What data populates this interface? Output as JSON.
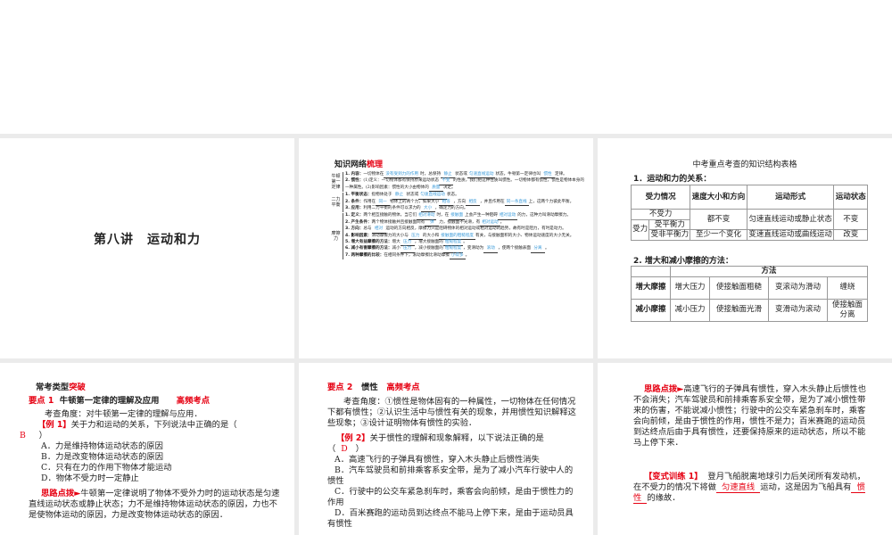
{
  "slide1": {
    "title": "第八讲　运动和力"
  },
  "slide2": {
    "title_black": "知识网络",
    "title_red": "梳理",
    "groups": [
      {
        "label": "牛顿第一定律",
        "items": [
          [
            "1. 内容：",
            "一切物体在",
            [
              "没有受到力的作用"
            ],
            "时，总保持",
            [
              "静止"
            ],
            "状态或",
            [
              "匀速直线运动"
            ],
            "状态，牛顿第一定律也叫",
            [
              "惯性"
            ],
            "定律。"
          ],
          [
            "2. 惯性：",
            "(1)定义：一切物体都有保持原来运动状态",
            [
              "不变"
            ],
            "的性质，我们把这种性质叫惯性。一切物体都有惯性，惯性是物体本身的一种属性。(2)影响因素：惯性的大小由物体的",
            [
              "质量"
            ],
            "决定。"
          ]
        ]
      },
      {
        "label": "二力平衡",
        "items": [
          [
            "1. 平衡状态：",
            "指物体处于",
            [
              "静止"
            ],
            "状态或",
            [
              "匀速直线运动"
            ],
            "状态。"
          ],
          [
            "2. 条件：",
            "作用在",
            [
              "同一"
            ],
            "物体上的两个力，如果大小",
            [
              "相等"
            ],
            "，方向",
            [
              "相反"
            ],
            "，并且作用在",
            [
              "同一条直线"
            ],
            "上，这两个力彼此平衡。"
          ],
          [
            "3. 应用：",
            "利用二力平衡的条件可以求力的",
            [
              "大小"
            ],
            "，确定力的方向。"
          ]
        ]
      },
      {
        "label": "摩擦力",
        "items": [
          [
            "1. 定义：",
            "两个相互接触的物体，当它们",
            [
              "相对滑动"
            ],
            "时，在",
            [
              "接触面"
            ],
            "上会产生一种阻碍",
            [
              "相对运动"
            ],
            "的力，这种力叫滑动摩擦力。"
          ],
          [
            "2. 产生条件：",
            "两个物体接触并且接触面间有",
            [
              "弹"
            ],
            "力，接触面不光滑，有",
            [
              "相对运动"
            ],
            "。"
          ],
          [
            "3. 方向：",
            "总与",
            [
              "相对"
            ],
            "运动的方向相反，摩擦力只是阻碍物体的相对运动或相对运动的趋势，故有时是阻力，有时是动力。"
          ],
          [
            "4. 影响因素：",
            "滑动摩擦力的大小与",
            [
              "压力"
            ],
            "的大小和",
            [
              "接触面的粗糙程度"
            ],
            "有关，与接触面积的大小、物体运动速度的大小无关。"
          ],
          [
            "5. 增大有益摩擦的方法：",
            "增大",
            [
              "压力"
            ],
            "，增大接触面的",
            [
              "粗糙程度"
            ],
            "。"
          ],
          [
            "6. 减小有害摩擦的方法：",
            "减小",
            [
              "压力"
            ],
            "，减小接触面的",
            [
              "粗糙程度"
            ],
            "，变滑动为",
            [
              "滚动"
            ],
            "，使两个接触表面",
            [
              "分离"
            ],
            "。"
          ],
          [
            "7. 两种摩擦的比较：",
            "在相同条件下，滚动摩擦比滑动摩擦",
            [
              "小得多"
            ],
            "。"
          ]
        ]
      }
    ]
  },
  "slide3": {
    "heading": "中考重点考查的知识结构表格",
    "sub1": "1．运动和力的关系：",
    "t1": {
      "h": [
        "受力情况",
        "速度大小和方向",
        "运动形式",
        "运动状态"
      ],
      "r1": [
        "不受力",
        "都不变",
        "匀速直线运动或静止状态",
        "不变"
      ],
      "r2": "受平衡力",
      "r3": [
        "受力",
        "受非平衡力",
        "至少一个变化",
        "变速直线运动或曲线运动",
        "改变"
      ]
    },
    "sub2": "2. 增大和减小摩擦的方法：",
    "t2": {
      "h": "方法",
      "r1": [
        "增大摩擦",
        "增大压力",
        "使接触面粗糙",
        "变滚动为滑动",
        "缠绕"
      ],
      "r2": [
        "减小摩擦",
        "减小压力",
        "使接触面光滑",
        "变滑动为滚动",
        "使接触面分离"
      ]
    }
  },
  "slide4": {
    "h_black": "常考类型",
    "h_red": "突破",
    "point_red": "要点 1",
    "point": "牛顿第一定律的理解及应用",
    "freq": "高频考点",
    "angle": "考查角度：对牛顿第一定律的理解与应用．",
    "ex": "【例 1】",
    "q": "关于力和运动的关系，下列说法中正确的是（",
    "ans": "B",
    "close": "）",
    "opts": [
      "A．力是维持物体运动状态的原因",
      "B．力是改变物体运动状态的原因",
      "C．只有在力的作用下物体才能运动",
      "D．物体不受力时一定静止"
    ],
    "hint": "思路点拨►",
    "hint_text": "牛顿第一定律说明了物体不受外力时的运动状态是匀速直线运动状态或静止状态；力不是维持物体运动状态的原因，力也不是使物体运动的原因，力是改变物体运动状态的原因．"
  },
  "slide5": {
    "point_red": "要点 2",
    "point": "惯性",
    "freq": "高频考点",
    "angle": "考查角度：①惯性是物体固有的一种属性，一切物体在任何情况下都有惯性；②认识生活中与惯性有关的现象，并用惯性知识解释这些现象；③设计证明物体有惯性的实验．",
    "ex": "【例 2】",
    "q": "关于惯性的理解和现象解释，以下说法正确的是",
    "open": "（",
    "ans": "D",
    "close": "）",
    "opts": [
      "A．高速飞行的子弹具有惯性，穿入木头静止后惯性消失",
      "B．汽车驾驶员和前排乘客系安全带，是为了减小汽车行驶中人的惯性",
      "C．行驶中的公交车紧急刹车时，乘客会向前倾，是由于惯性力的作用",
      "D．百米赛跑的运动员到达终点不能马上停下来，是由于运动员具有惯性"
    ]
  },
  "slide6": {
    "hint": "思路点拨►",
    "hint_text": "高速飞行的子弹具有惯性，穿入木头静止后惯性也不会消失；汽车驾驶员和前排乘客系安全带，是为了减小惯性带来的伤害，不能说减小惯性；行驶中的公交车紧急刹车时，乘客会向前倾，是由于惯性的作用，惯性不是力；百米赛跑的运动员到达终点后由于具有惯性，还要保持原来的运动状态，所以不能马上停下来．",
    "ex": "【变式训练 1】",
    "q1": "登月飞船脱离地球引力后关闭所有发动机，在不受力的情况下将做",
    "a1": "匀速直线",
    "q2": "运动，这是因为飞船具有",
    "a2": "惯性",
    "q3": "的缘故．"
  }
}
